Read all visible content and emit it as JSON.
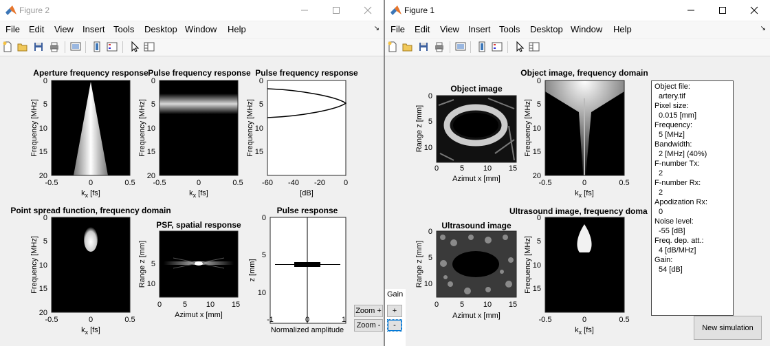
{
  "menu_items": [
    "File",
    "Edit",
    "View",
    "Insert",
    "Tools",
    "Desktop",
    "Window",
    "Help"
  ],
  "accent": "#0078d7",
  "figure2": {
    "title": "Figure 2",
    "ax1": {
      "title": "Aperture frequency response",
      "ylabel": "Frequency [MHz]",
      "yticks": [
        "0",
        "5",
        "10",
        "15",
        "20"
      ],
      "xticks": [
        "-0.5",
        "0",
        "0.5"
      ]
    },
    "ax2": {
      "title": "Pulse frequency response",
      "ylabel": "Frequency [MHz]",
      "yticks": [
        "0",
        "5",
        "10",
        "15",
        "20"
      ],
      "xticks": [
        "-0.5",
        "0",
        "0.5"
      ]
    },
    "ax3": {
      "title": "Pulse frequency response",
      "ylabel": "Frequency [MHz]",
      "yticks": [
        "0",
        "5",
        "10",
        "15"
      ],
      "xticks": [
        "-60",
        "-40",
        "-20",
        "0"
      ],
      "xlabel": "[dB]"
    },
    "ax4": {
      "title": "Point spread function, frequency domain",
      "ylabel": "Frequency [MHz]",
      "yticks": [
        "0",
        "5",
        "10",
        "15",
        "20"
      ],
      "xticks": [
        "-0.5",
        "0",
        "0.5"
      ]
    },
    "ax5": {
      "title": "PSF, spatial response",
      "ylabel": "Range z [mm]",
      "yticks": [
        "5",
        "10"
      ],
      "xticks": [
        "0",
        "5",
        "10",
        "15"
      ],
      "xlabel": "Azimut x [mm]"
    },
    "ax6": {
      "title": "Pulse response",
      "ylabel": "z [mm]",
      "yticks": [
        "0",
        "5",
        "10"
      ],
      "xticks": [
        "-1",
        "0",
        "1"
      ],
      "xlabel": "Normalized amplitude"
    },
    "kx_main": "k",
    "kx_sub": "x",
    "kx_unit": "[fs]",
    "gain_label": "Gain",
    "zoom_plus": "Zoom +",
    "zoom_minus": "Zoom -",
    "plus": "+",
    "minus": "-"
  },
  "figure1": {
    "title": "Figure 1",
    "ax1": {
      "title": "Object image",
      "ylabel": "Range z [mm]",
      "yticks": [
        "0",
        "5",
        "10"
      ],
      "xticks": [
        "0",
        "5",
        "10",
        "15"
      ],
      "xlabel": "Azimut x [mm]"
    },
    "ax2": {
      "title": "Object image, frequency domain",
      "ylabel": "Frequency [MHz]",
      "yticks": [
        "0",
        "5",
        "10",
        "15",
        "20"
      ],
      "xticks": [
        "-0.5",
        "0",
        "0.5"
      ]
    },
    "ax3": {
      "title": "Ultrasound image",
      "ylabel": "Range z [mm]",
      "yticks": [
        "0",
        "5",
        "10"
      ],
      "xticks": [
        "0",
        "5",
        "10",
        "15"
      ],
      "xlabel": "Azimut x [mm]"
    },
    "ax4": {
      "title": "Ultrasound image, frequency doma",
      "ylabel": "Frequency [MHz]",
      "yticks": [
        "0",
        "5",
        "10",
        "15"
      ],
      "xticks": [
        "-0.5",
        "0",
        "0.5"
      ]
    },
    "info": [
      {
        "label": "Object file:",
        "value": "artery.tif"
      },
      {
        "label": "Pixel size:",
        "value": "0.015 [mm]"
      },
      {
        "label": "Frequency:",
        "value": "5 [MHz]"
      },
      {
        "label": "Bandwidth:",
        "value": "2 [MHz] (40%)"
      },
      {
        "label": "F-number Tx:",
        "value": "2"
      },
      {
        "label": "F-number Rx:",
        "value": "2"
      },
      {
        "label": "Apodization Rx:",
        "value": "0"
      },
      {
        "label": "Noise level:",
        "value": "-55 [dB]"
      },
      {
        "label": "Freq. dep. att.:",
        "value": "4 [dB/MHz]"
      },
      {
        "label": "Gain:",
        "value": "54 [dB]"
      }
    ],
    "new_sim": "New simulation"
  }
}
